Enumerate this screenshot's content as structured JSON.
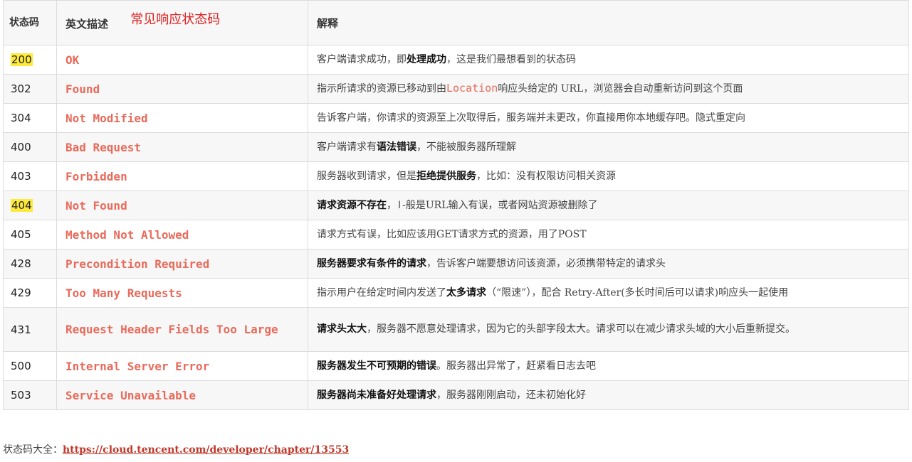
{
  "header": {
    "col_code": "状态码",
    "col_name": "英文描述",
    "overlay_title": "常见响应状态码",
    "col_desc": "解释"
  },
  "rows": [
    {
      "code": "200",
      "highlight": true,
      "name": "OK",
      "desc": [
        {
          "t": "客户端请求成功，即"
        },
        {
          "t": "处理成功",
          "b": true
        },
        {
          "t": "，这是我们最想看到的状态码"
        }
      ]
    },
    {
      "code": "302",
      "name": "Found",
      "desc": [
        {
          "t": "指示所请求的资源已移动到由"
        },
        {
          "t": "Location",
          "m": true
        },
        {
          "t": "响应头给定的 URL，浏览器会自动重新访问到这个页面"
        }
      ]
    },
    {
      "code": "304",
      "name": "Not Modified",
      "desc": [
        {
          "t": "告诉客户端，你请求的资源至上次取得后，服务端并未更改，你直接用你本地缓存吧。隐式重定向"
        }
      ]
    },
    {
      "code": "400",
      "name": "Bad Request",
      "desc": [
        {
          "t": "客户端请求有"
        },
        {
          "t": "语法错误",
          "b": true
        },
        {
          "t": "，不能被服务器所理解"
        }
      ]
    },
    {
      "code": "403",
      "name": "Forbidden",
      "desc": [
        {
          "t": "服务器收到请求，但是"
        },
        {
          "t": "拒绝提供服务",
          "b": true
        },
        {
          "t": "，比如：没有权限访问相关资源"
        }
      ]
    },
    {
      "code": "404",
      "highlight": true,
      "name": "Not Found",
      "desc": [
        {
          "t": "请求资源不存在",
          "b": true
        },
        {
          "t": "，"
        },
        {
          "t": "I",
          "c": true
        },
        {
          "t": "-般是URL输入有误，或者网站资源被删除了"
        }
      ]
    },
    {
      "code": "405",
      "name": "Method Not Allowed",
      "desc": [
        {
          "t": "请求方式有误，比如应该用GET请求方式的资源，用了POST"
        }
      ]
    },
    {
      "code": "428",
      "name": "Precondition Required",
      "desc": [
        {
          "t": "服务器要求有条件的请求",
          "b": true
        },
        {
          "t": "，告诉客户端要想访问该资源，必须携带特定的请求头"
        }
      ]
    },
    {
      "code": "429",
      "name": "Too Many Requests",
      "desc": [
        {
          "t": "指示用户在给定时间内发送了"
        },
        {
          "t": "太多请求",
          "b": true
        },
        {
          "t": "（“限速”），配合 Retry-After(多长时间后可以请求)响应头一起使用"
        }
      ]
    },
    {
      "code": "431",
      "tall": true,
      "name": "Request Header Fields Too Large",
      "desc": [
        {
          "t": "请求头太大",
          "b": true
        },
        {
          "t": "，服务器不愿意处理请求，因为它的头部字段太大。请求可以在减少请求头域的大小后重新提交。"
        }
      ]
    },
    {
      "code": "500",
      "name": "Internal Server Error",
      "desc": [
        {
          "t": "服务器发生不可预期的错误",
          "b": true
        },
        {
          "t": "。服务器出异常了，赶紧看日志去吧"
        }
      ]
    },
    {
      "code": "503",
      "name": "Service Unavailable",
      "desc": [
        {
          "t": "服务器尚未准备好处理请求",
          "b": true
        },
        {
          "t": "，服务器刚刚启动，还未初始化好"
        }
      ]
    }
  ],
  "footer": {
    "label": "状态码大全：",
    "link": "https://cloud.tencent.com/developer/chapter/13553"
  },
  "colors": {
    "name_text": "#e96a5a",
    "overlay_title": "#e02020",
    "highlight": "#fde93a",
    "link": "#c0392b"
  }
}
